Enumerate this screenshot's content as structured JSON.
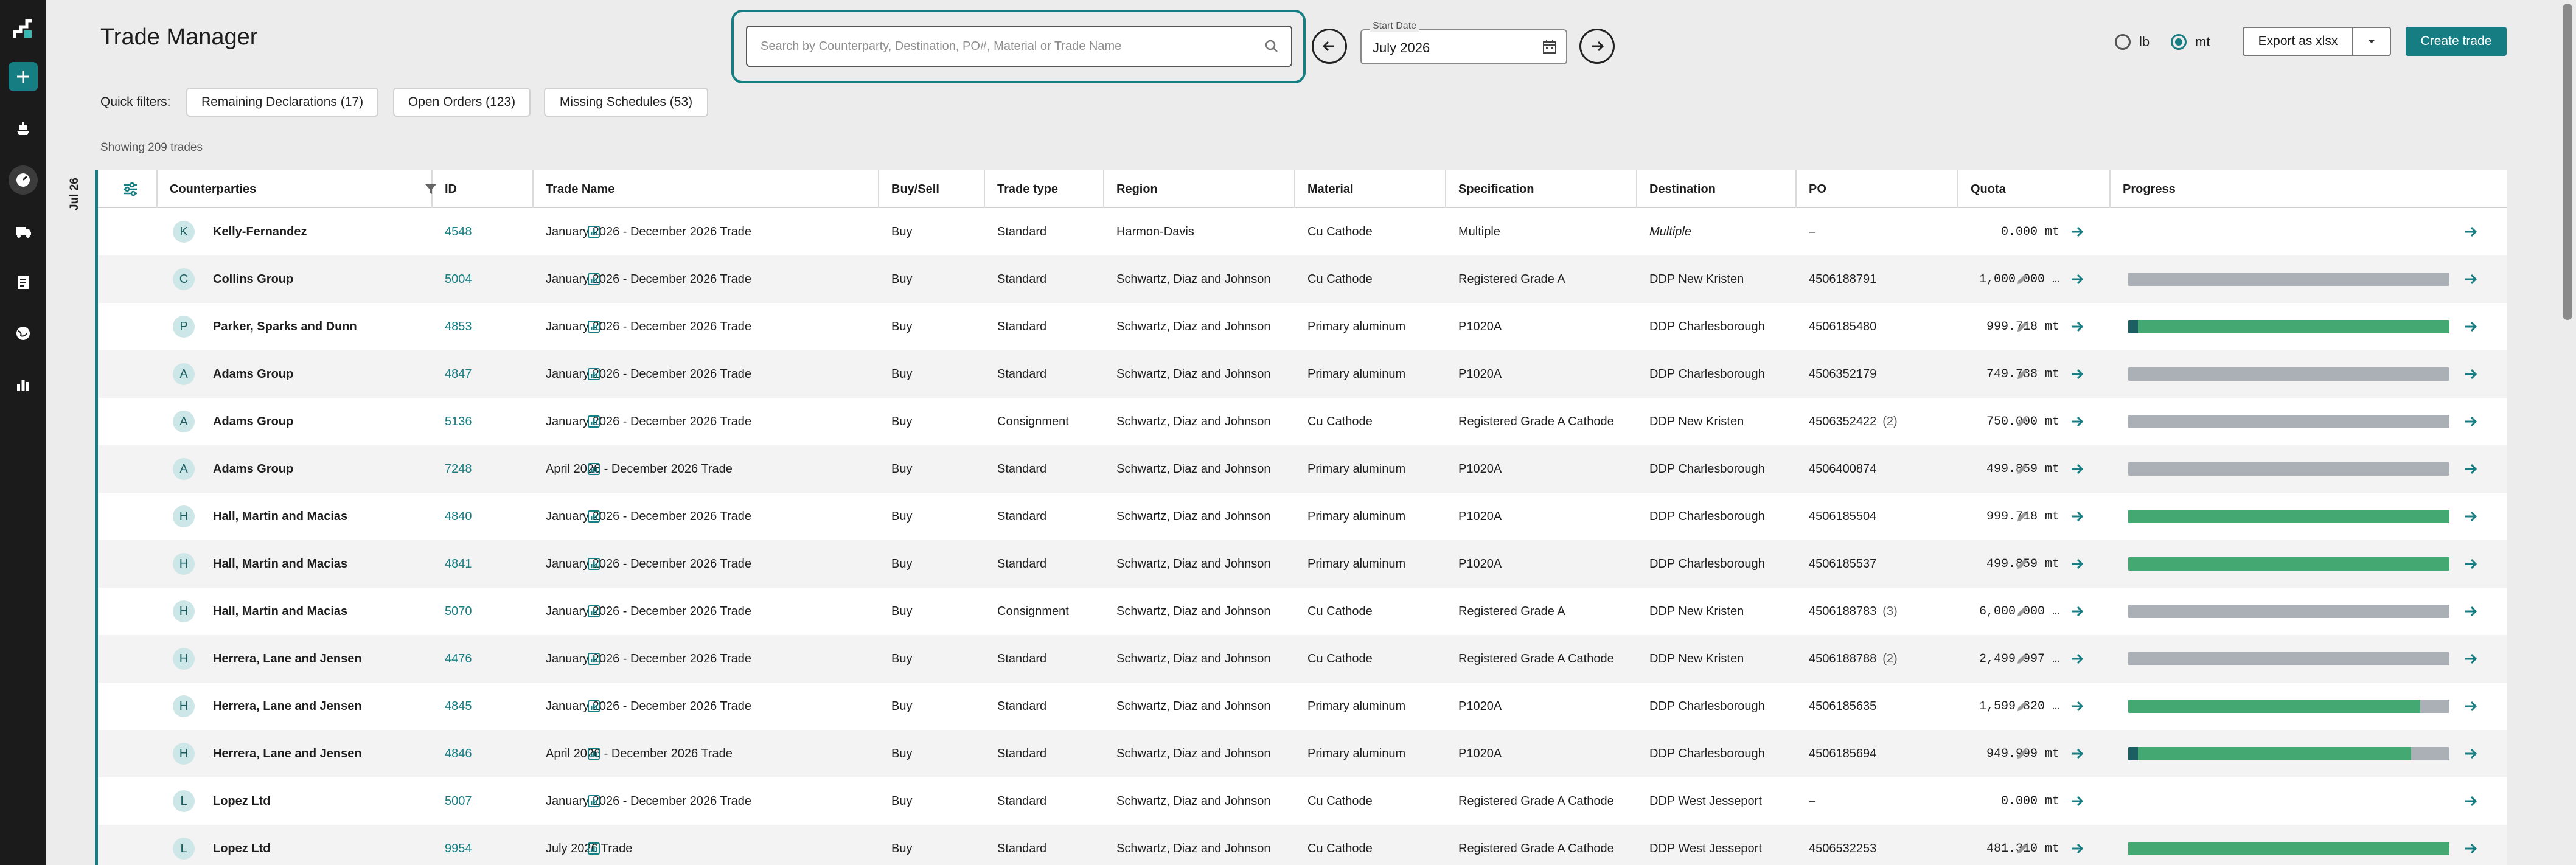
{
  "header": {
    "title": "Trade Manager",
    "search_placeholder": "Search by Counterparty, Destination, PO#, Material or Trade Name",
    "start_date_label": "Start Date",
    "start_date_value": "July 2026",
    "unit_options": [
      "lb",
      "mt"
    ],
    "unit_selected": "mt",
    "export_label": "Export as xlsx",
    "create_label": "Create trade"
  },
  "quick_filters": {
    "label": "Quick filters:",
    "chips": [
      "Remaining Declarations (17)",
      "Open Orders (123)",
      "Missing Schedules (53)"
    ]
  },
  "showing_text": "Showing 209 trades",
  "side_date": "Jul 26",
  "columns": [
    "Counterparties",
    "ID",
    "Trade Name",
    "Buy/Sell",
    "Trade type",
    "Region",
    "Material",
    "Specification",
    "Destination",
    "PO",
    "Quota",
    "Progress"
  ],
  "rows": [
    {
      "initial": "K",
      "counterparty": "Kelly-Fernandez",
      "id": "4548",
      "trade_name": "January 2026 - December 2026 Trade",
      "buy_sell": "Buy",
      "trade_type": "Standard",
      "region": "Harmon-Davis",
      "material": "Cu Cathode",
      "spec": "Multiple",
      "destination": "Multiple",
      "destination_italic": true,
      "po": "–",
      "po_count": "",
      "po_edit": false,
      "quota": "0.000 mt",
      "progress": null
    },
    {
      "initial": "C",
      "counterparty": "Collins Group",
      "id": "5004",
      "trade_name": "January 2026 - December 2026 Trade",
      "buy_sell": "Buy",
      "trade_type": "Standard",
      "region": "Schwartz, Diaz and Johnson",
      "material": "Cu Cathode",
      "spec": "Registered Grade A",
      "destination": "DDP New Kristen",
      "po": "4506188791",
      "po_count": "",
      "po_edit": true,
      "quota": "1,000.000 …",
      "progress": 0
    },
    {
      "initial": "P",
      "counterparty": "Parker, Sparks and Dunn",
      "id": "4853",
      "trade_name": "January 2026 - December 2026 Trade",
      "buy_sell": "Buy",
      "trade_type": "Standard",
      "region": "Schwartz, Diaz and Johnson",
      "material": "Primary aluminum",
      "spec": "P1020A",
      "destination": "DDP Charlesborough",
      "po": "4506185480",
      "po_count": "",
      "po_edit": true,
      "quota": "999.718 mt",
      "progress": 1.0,
      "start_marker": true
    },
    {
      "initial": "A",
      "counterparty": "Adams Group",
      "id": "4847",
      "trade_name": "January 2026 - December 2026 Trade",
      "buy_sell": "Buy",
      "trade_type": "Standard",
      "region": "Schwartz, Diaz and Johnson",
      "material": "Primary aluminum",
      "spec": "P1020A",
      "destination": "DDP Charlesborough",
      "po": "4506352179",
      "po_count": "",
      "po_edit": true,
      "quota": "749.788 mt",
      "progress": 0
    },
    {
      "initial": "A",
      "counterparty": "Adams Group",
      "id": "5136",
      "trade_name": "January 2026 - December 2026 Trade",
      "buy_sell": "Buy",
      "trade_type": "Consignment",
      "region": "Schwartz, Diaz and Johnson",
      "material": "Cu Cathode",
      "spec": "Registered Grade A Cathode",
      "destination": "DDP New Kristen",
      "po": "4506352422",
      "po_count": "(2)",
      "po_edit": true,
      "quota": "750.000 mt",
      "progress": 0
    },
    {
      "initial": "A",
      "counterparty": "Adams Group",
      "id": "7248",
      "trade_name": "April 2026 - December 2026 Trade",
      "buy_sell": "Buy",
      "trade_type": "Standard",
      "region": "Schwartz, Diaz and Johnson",
      "material": "Primary aluminum",
      "spec": "P1020A",
      "destination": "DDP Charlesborough",
      "po": "4506400874",
      "po_count": "",
      "po_edit": true,
      "quota": "499.859 mt",
      "progress": 0
    },
    {
      "initial": "H",
      "counterparty": "Hall, Martin and Macias",
      "id": "4840",
      "trade_name": "January 2026 - December 2026 Trade",
      "buy_sell": "Buy",
      "trade_type": "Standard",
      "region": "Schwartz, Diaz and Johnson",
      "material": "Primary aluminum",
      "spec": "P1020A",
      "destination": "DDP Charlesborough",
      "po": "4506185504",
      "po_count": "",
      "po_edit": true,
      "quota": "999.718 mt",
      "progress": 1.0
    },
    {
      "initial": "H",
      "counterparty": "Hall, Martin and Macias",
      "id": "4841",
      "trade_name": "January 2026 - December 2026 Trade",
      "buy_sell": "Buy",
      "trade_type": "Standard",
      "region": "Schwartz, Diaz and Johnson",
      "material": "Primary aluminum",
      "spec": "P1020A",
      "destination": "DDP Charlesborough",
      "po": "4506185537",
      "po_count": "",
      "po_edit": true,
      "quota": "499.859 mt",
      "progress": 1.0
    },
    {
      "initial": "H",
      "counterparty": "Hall, Martin and Macias",
      "id": "5070",
      "trade_name": "January 2026 - December 2026 Trade",
      "buy_sell": "Buy",
      "trade_type": "Consignment",
      "region": "Schwartz, Diaz and Johnson",
      "material": "Cu Cathode",
      "spec": "Registered Grade A",
      "destination": "DDP New Kristen",
      "po": "4506188783",
      "po_count": "(3)",
      "po_edit": true,
      "quota": "6,000.000 …",
      "progress": 0
    },
    {
      "initial": "H",
      "counterparty": "Herrera, Lane and Jensen",
      "id": "4476",
      "trade_name": "January 2026 - December 2026 Trade",
      "buy_sell": "Buy",
      "trade_type": "Standard",
      "region": "Schwartz, Diaz and Johnson",
      "material": "Cu Cathode",
      "spec": "Registered Grade A Cathode",
      "destination": "DDP New Kristen",
      "po": "4506188788",
      "po_count": "(2)",
      "po_edit": true,
      "quota": "2,499.997 …",
      "progress": 0
    },
    {
      "initial": "H",
      "counterparty": "Herrera, Lane and Jensen",
      "id": "4845",
      "trade_name": "January 2026 - December 2026 Trade",
      "buy_sell": "Buy",
      "trade_type": "Standard",
      "region": "Schwartz, Diaz and Johnson",
      "material": "Primary aluminum",
      "spec": "P1020A",
      "destination": "DDP Charlesborough",
      "po": "4506185635",
      "po_count": "",
      "po_edit": true,
      "quota": "1,599.820 …",
      "progress": 0.91
    },
    {
      "initial": "H",
      "counterparty": "Herrera, Lane and Jensen",
      "id": "4846",
      "trade_name": "April 2026 - December 2026 Trade",
      "buy_sell": "Buy",
      "trade_type": "Standard",
      "region": "Schwartz, Diaz and Johnson",
      "material": "Primary aluminum",
      "spec": "P1020A",
      "destination": "DDP Charlesborough",
      "po": "4506185694",
      "po_count": "",
      "po_edit": true,
      "quota": "949.999 mt",
      "progress": 0.88,
      "start_marker": true
    },
    {
      "initial": "L",
      "counterparty": "Lopez Ltd",
      "id": "5007",
      "trade_name": "January 2026 - December 2026 Trade",
      "buy_sell": "Buy",
      "trade_type": "Standard",
      "region": "Schwartz, Diaz and Johnson",
      "material": "Cu Cathode",
      "spec": "Registered Grade A Cathode",
      "destination": "DDP West Jesseport",
      "po": "–",
      "po_count": "",
      "po_edit": false,
      "quota": "0.000 mt",
      "progress": null
    },
    {
      "initial": "L",
      "counterparty": "Lopez Ltd",
      "id": "9954",
      "trade_name": "July 2026 Trade",
      "buy_sell": "Buy",
      "trade_type": "Standard",
      "region": "Schwartz, Diaz and Johnson",
      "material": "Cu Cathode",
      "spec": "Registered Grade A Cathode",
      "destination": "DDP West Jesseport",
      "po": "4506532253",
      "po_count": "",
      "po_edit": true,
      "quota": "481.310 mt",
      "progress": 1.0
    }
  ],
  "colors": {
    "accent": "#167e82",
    "progress_fill": "#44a873",
    "progress_track": "#aab0b5"
  },
  "icons": [
    "logo-icon",
    "plus-icon",
    "ship-icon",
    "dashboard-icon",
    "truck-icon",
    "document-icon",
    "globe-icon",
    "chart-icon",
    "search-icon",
    "arrow-left-icon",
    "arrow-right-icon",
    "calendar-icon",
    "chevron-down-icon",
    "filter-icon",
    "settings-sliders-icon",
    "bar-chart-icon",
    "pencil-icon"
  ]
}
